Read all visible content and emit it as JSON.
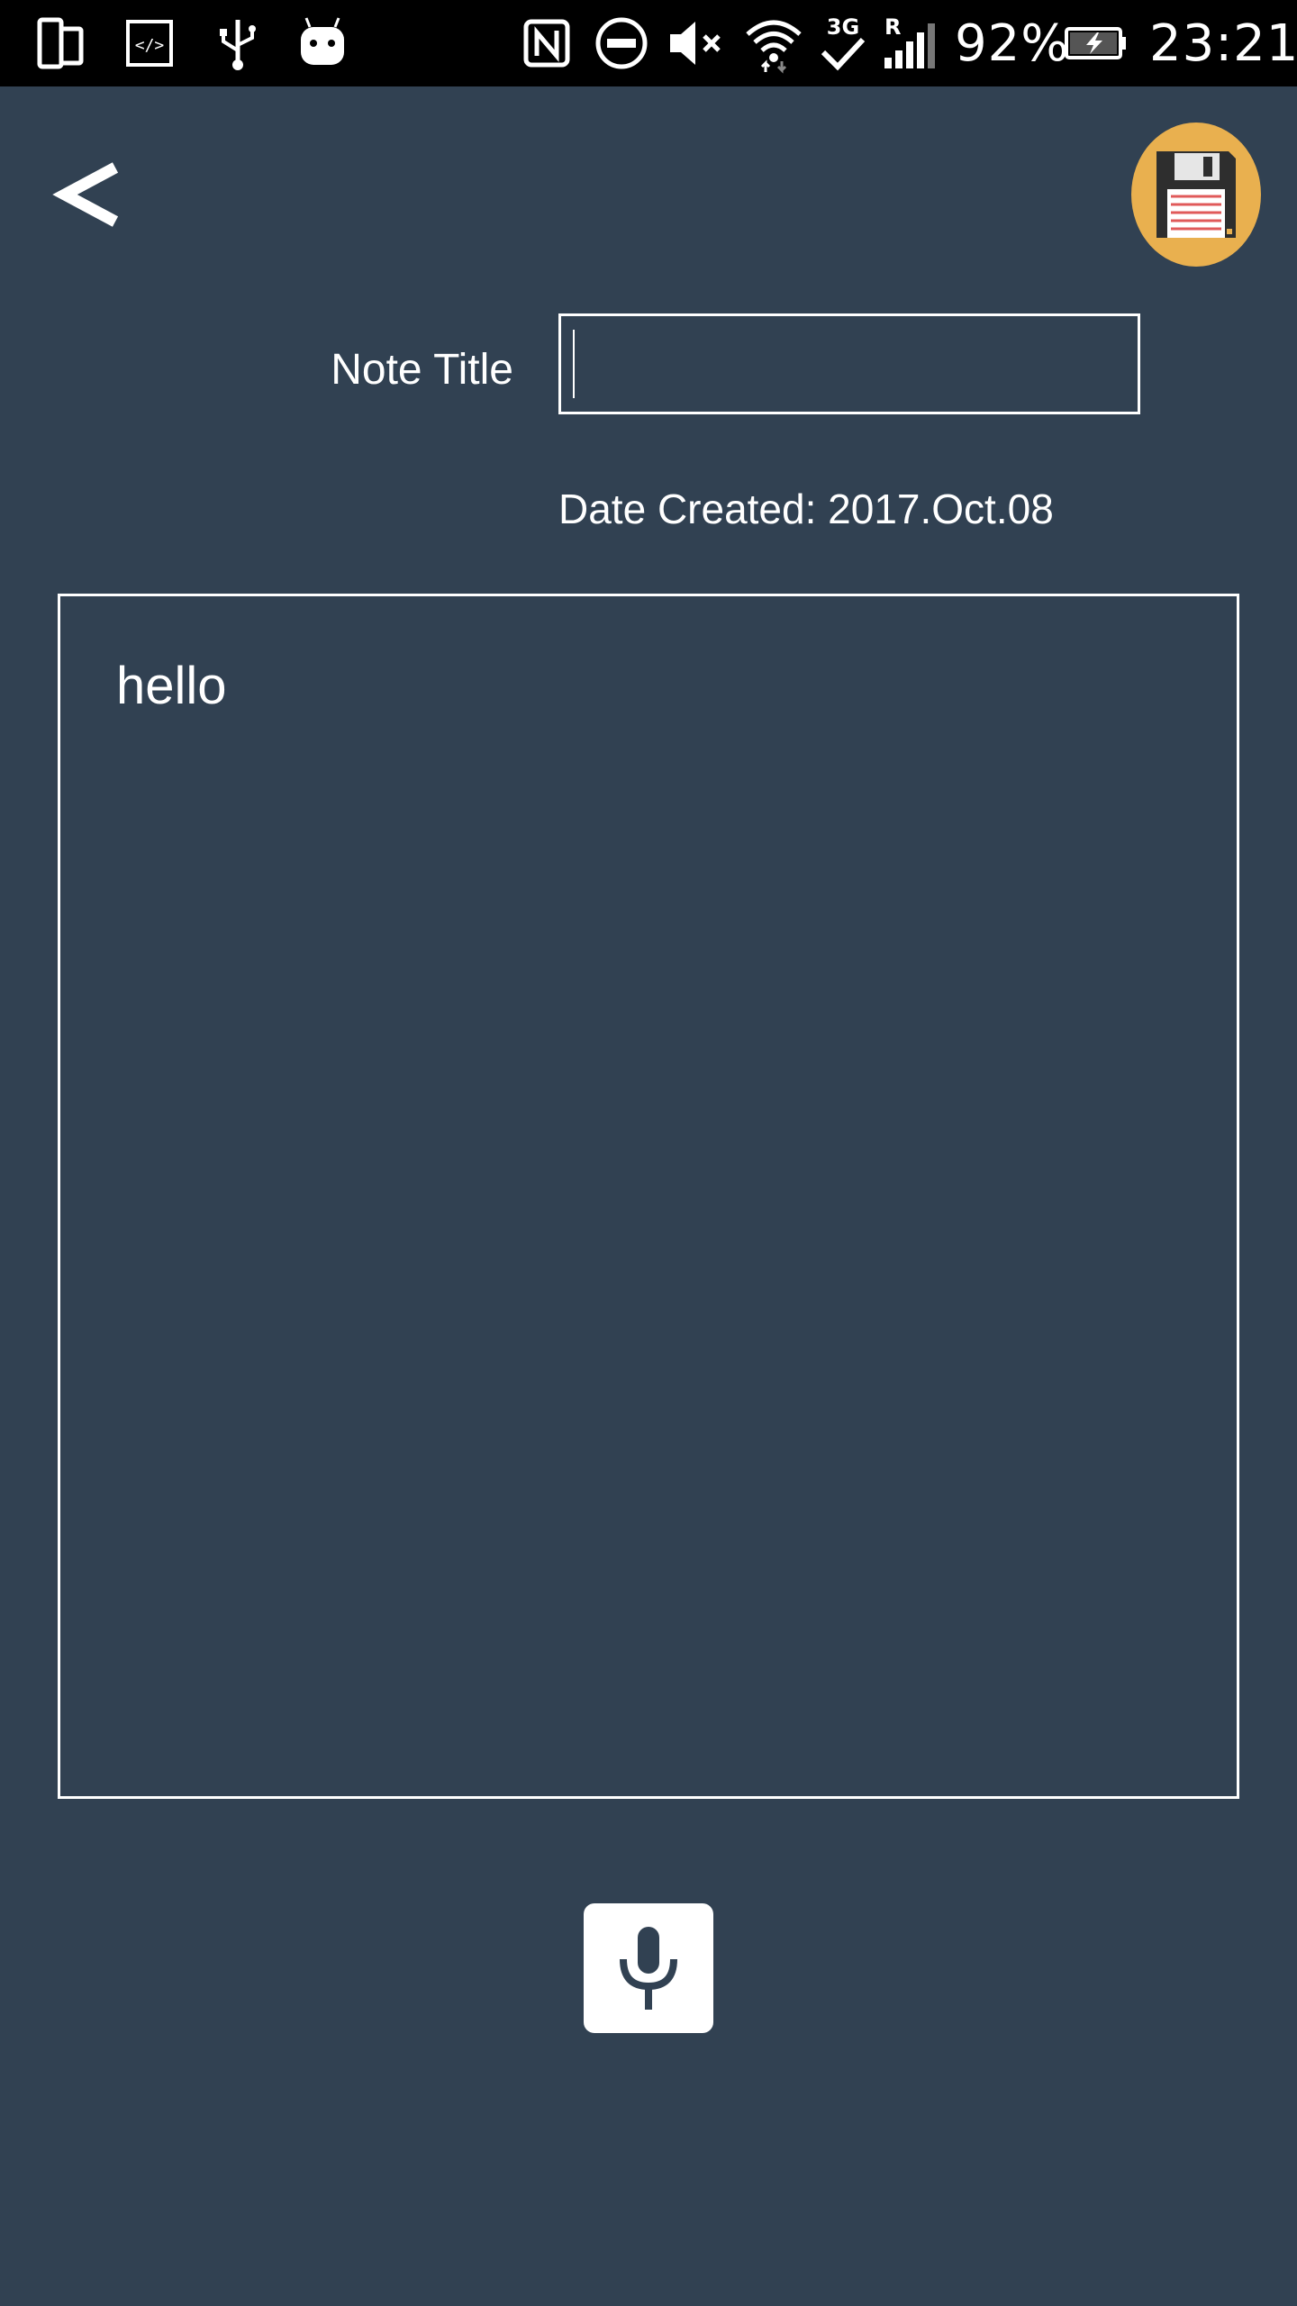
{
  "status_bar": {
    "icons": [
      "phone-tablet-icon",
      "code-icon",
      "usb-icon",
      "android-icon",
      "nfc-icon",
      "do-not-disturb-icon",
      "mute-icon",
      "wifi-icon",
      "network-3g-icon",
      "signal-roaming-icon",
      "battery-charging-icon"
    ],
    "network_label": "3G",
    "roaming_label": "R",
    "battery_percent": "92%",
    "time": "23:21"
  },
  "header": {
    "back_icon": "chevron-left-icon",
    "save_icon": "floppy-disk-icon",
    "save_color": "#e9b04f"
  },
  "form": {
    "title_label": "Note Title",
    "title_value": "",
    "date_created": "Date Created: 2017.Oct.08"
  },
  "note": {
    "body_text": "hello"
  },
  "actions": {
    "mic_icon": "microphone-icon"
  },
  "colors": {
    "background": "#314152",
    "status_bar": "#000000",
    "foreground": "#ffffff"
  }
}
